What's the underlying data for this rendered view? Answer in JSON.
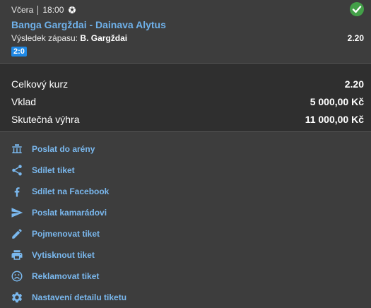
{
  "bet": {
    "day": "Včera",
    "time": "18:00",
    "match": "Banga Gargždai - Dainava Alytus",
    "outcome_label": "Výsledek zápasu:",
    "outcome_value": "B. Gargždai",
    "odd": "2.20",
    "score": "2:0",
    "status": "won"
  },
  "summary": {
    "total_odd_label": "Celkový kurz",
    "total_odd": "2.20",
    "stake_label": "Vklad",
    "stake": "5 000,00 Kč",
    "win_label": "Skutečná výhra",
    "win": "11 000,00 Kč"
  },
  "actions": [
    {
      "label": "Poslat do arény",
      "icon": "arena-icon"
    },
    {
      "label": "Sdílet tiket",
      "icon": "share-icon"
    },
    {
      "label": "Sdílet na Facebook",
      "icon": "facebook-icon"
    },
    {
      "label": "Poslat kamarádovi",
      "icon": "send-icon"
    },
    {
      "label": "Pojmenovat tiket",
      "icon": "pencil-icon"
    },
    {
      "label": "Vytisknout tiket",
      "icon": "printer-icon"
    },
    {
      "label": "Reklamovat tiket",
      "icon": "sad-face-icon"
    },
    {
      "label": "Nastavení detailu tiketu",
      "icon": "gear-icon"
    }
  ],
  "colors": {
    "accent": "#7ab8ee",
    "success": "#43a048",
    "score_bg": "#1e88e5"
  }
}
